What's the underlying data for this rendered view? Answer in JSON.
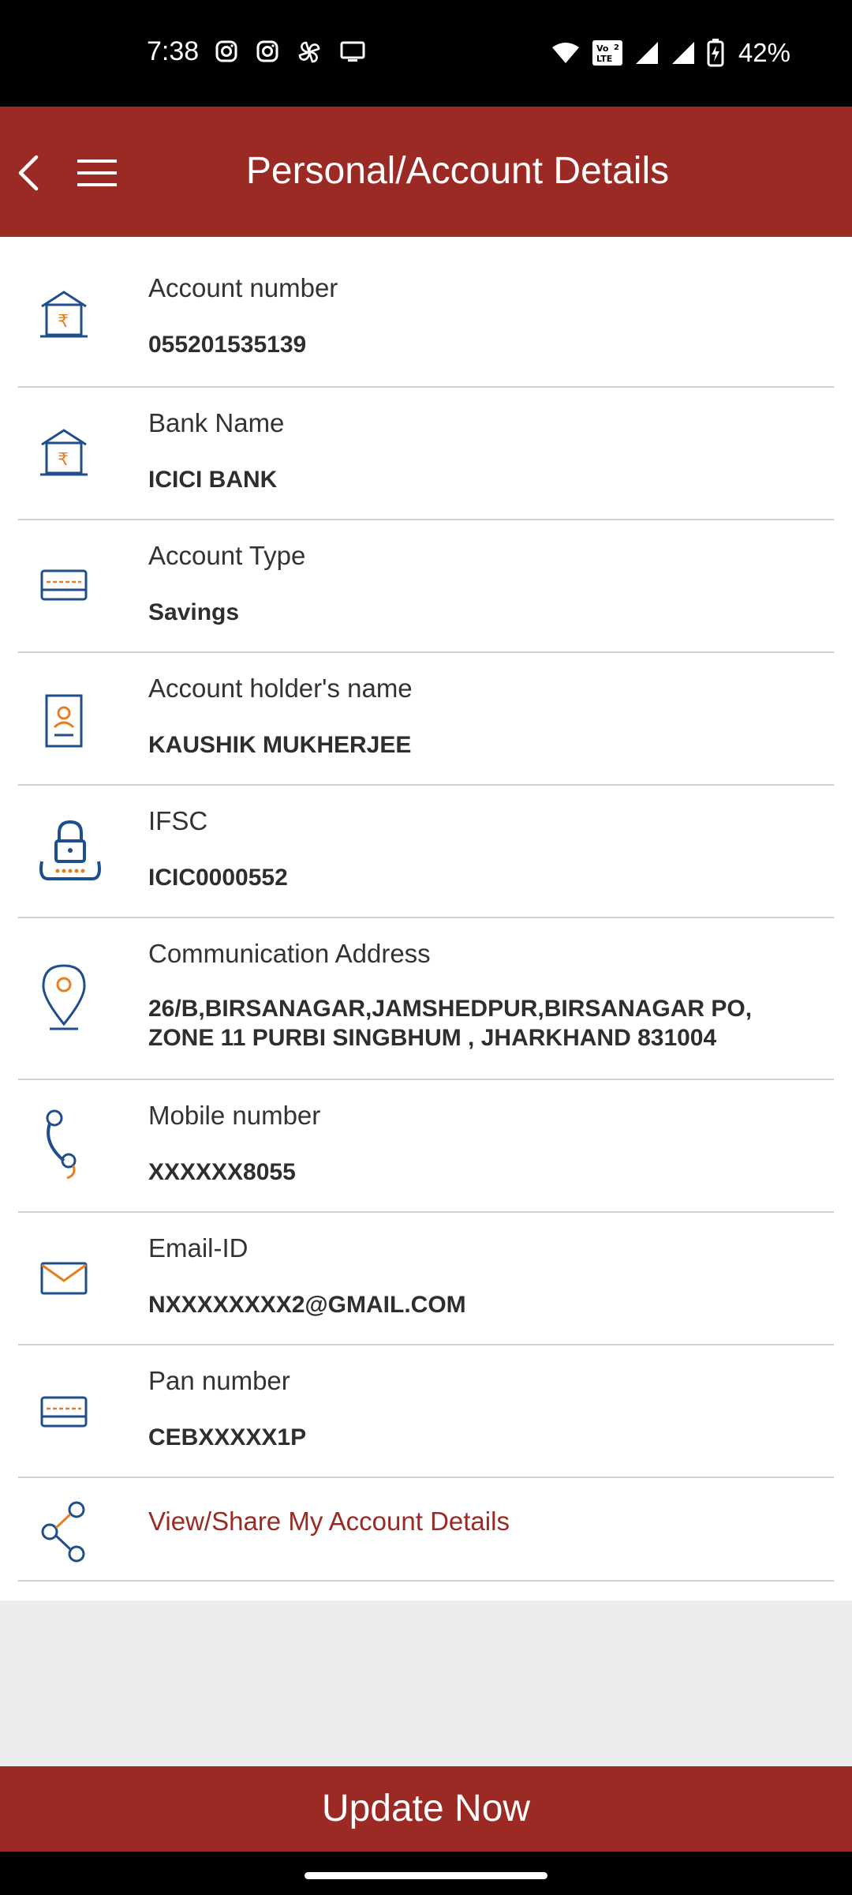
{
  "status": {
    "time": "7:38",
    "battery": "42%",
    "left_icons": [
      "instagram-icon",
      "instagram-icon",
      "pinwheel-icon",
      "cast-icon"
    ],
    "right_icons": [
      "wifi-icon",
      "volte-icon",
      "signal-icon",
      "signal-icon",
      "battery-charging-icon"
    ]
  },
  "header": {
    "title": "Personal/Account Details",
    "back_icon": "back-arrow-icon",
    "menu_icon": "hamburger-menu-icon"
  },
  "details": [
    {
      "label": "Account number",
      "value": "055201535139",
      "icon": "bank-rupee-icon"
    },
    {
      "label": "Bank Name",
      "value": "ICICI BANK",
      "icon": "bank-rupee-icon"
    },
    {
      "label": "Account Type",
      "value": "Savings",
      "icon": "card-icon"
    },
    {
      "label": "Account holder's name",
      "value": "KAUSHIK MUKHERJEE",
      "icon": "id-card-icon"
    },
    {
      "label": "IFSC",
      "value": "ICIC0000552",
      "icon": "lock-icon"
    },
    {
      "label": "Communication Address",
      "value": "26/B,BIRSANAGAR,JAMSHEDPUR,BIRSANAGAR PO,\nZONE 11 PURBI SINGBHUM , JHARKHAND 831004",
      "icon": "location-pin-icon"
    },
    {
      "label": "Mobile number",
      "value": "XXXXXX8055",
      "icon": "phone-icon"
    },
    {
      "label": "Email-ID",
      "value": "NXXXXXXXX2@GMAIL.COM",
      "icon": "mail-icon"
    },
    {
      "label": "Pan number",
      "value": "CEBXXXXX1P",
      "icon": "card-icon"
    }
  ],
  "share": {
    "label": "View/Share My Account Details",
    "icon": "share-icon"
  },
  "update_button": "Update Now",
  "colors": {
    "primary": "#9b2a24",
    "icon_blue": "#1f4e8c",
    "icon_orange": "#e67e22"
  }
}
